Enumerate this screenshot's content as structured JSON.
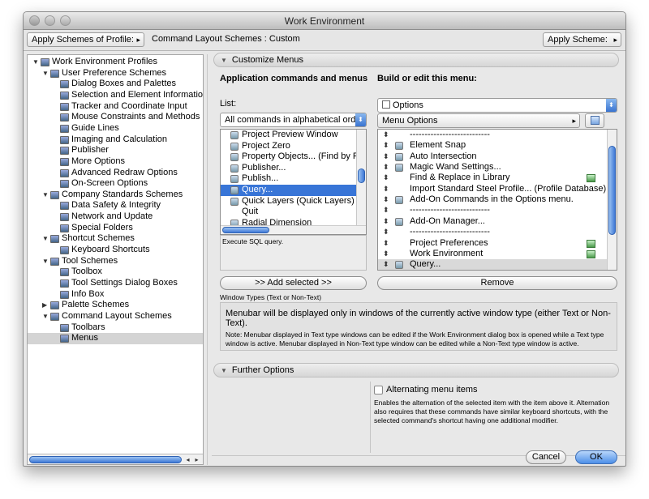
{
  "window": {
    "title": "Work Environment"
  },
  "toolbar": {
    "apply_profile_label": "Apply Schemes of Profile:",
    "scheme_caption": "Command Layout Schemes : Custom",
    "apply_scheme_label": "Apply Scheme:"
  },
  "tree": {
    "items": [
      {
        "label": "Work Environment Profiles",
        "level": 0,
        "expanded": true,
        "icon": "folder-icon"
      },
      {
        "label": "User Preference Schemes",
        "level": 1,
        "expanded": true,
        "icon": "folder-icon"
      },
      {
        "label": "Dialog Boxes and Palettes",
        "level": 2,
        "icon": "dialog-icon"
      },
      {
        "label": "Selection and Element Information",
        "level": 2,
        "icon": "selection-icon"
      },
      {
        "label": "Tracker and Coordinate Input",
        "level": 2,
        "icon": "tracker-icon"
      },
      {
        "label": "Mouse Constraints and Methods",
        "level": 2,
        "icon": "mouse-icon"
      },
      {
        "label": "Guide Lines",
        "level": 2,
        "icon": "guide-icon"
      },
      {
        "label": "Imaging and Calculation",
        "level": 2,
        "icon": "imaging-icon"
      },
      {
        "label": "Publisher",
        "level": 2,
        "icon": "publisher-icon"
      },
      {
        "label": "More Options",
        "level": 2,
        "icon": "options-icon"
      },
      {
        "label": "Advanced Redraw Options",
        "level": 2,
        "icon": "redraw-icon"
      },
      {
        "label": "On-Screen Options",
        "level": 2,
        "icon": "screen-icon"
      },
      {
        "label": "Company Standards Schemes",
        "level": 1,
        "expanded": true,
        "icon": "folder-icon"
      },
      {
        "label": "Data Safety & Integrity",
        "level": 2,
        "icon": "safety-icon"
      },
      {
        "label": "Network and Update",
        "level": 2,
        "icon": "network-icon"
      },
      {
        "label": "Special Folders",
        "level": 2,
        "icon": "folder-icon"
      },
      {
        "label": "Shortcut Schemes",
        "level": 1,
        "expanded": true,
        "icon": "folder-icon"
      },
      {
        "label": "Keyboard Shortcuts",
        "level": 2,
        "icon": "keyboard-icon"
      },
      {
        "label": "Tool Schemes",
        "level": 1,
        "expanded": true,
        "icon": "folder-icon"
      },
      {
        "label": "Toolbox",
        "level": 2,
        "icon": "toolbox-icon"
      },
      {
        "label": "Tool Settings Dialog Boxes",
        "level": 2,
        "icon": "tool-settings-icon"
      },
      {
        "label": "Info Box",
        "level": 2,
        "icon": "info-icon"
      },
      {
        "label": "Palette Schemes",
        "level": 1,
        "expanded": false,
        "icon": "folder-icon"
      },
      {
        "label": "Command Layout Schemes",
        "level": 1,
        "expanded": true,
        "icon": "folder-icon"
      },
      {
        "label": "Toolbars",
        "level": 2,
        "icon": "toolbar-icon"
      },
      {
        "label": "Menus",
        "level": 2,
        "icon": "menu-icon",
        "selected": true
      }
    ]
  },
  "customize": {
    "header": "Customize Menus",
    "app_cmds_heading": "Application commands and menus",
    "list_label": "List:",
    "list_select": "All commands in alphabetical order",
    "commands": [
      {
        "label": "Project Preview Window",
        "icon": "preview-icon"
      },
      {
        "label": "Project Zero",
        "icon": "zero-icon"
      },
      {
        "label": "Property Objects... (Find by Prop",
        "icon": "property-icon"
      },
      {
        "label": "Publisher...",
        "icon": "publisher-icon"
      },
      {
        "label": "Publish...",
        "icon": "publish-icon"
      },
      {
        "label": "Query...",
        "icon": "query-icon",
        "selected": true
      },
      {
        "label": "Quick Layers (Quick Layers)",
        "icon": "layers-icon"
      },
      {
        "label": "Quit",
        "icon": ""
      },
      {
        "label": "Radial Dimension",
        "icon": "radial-icon"
      }
    ],
    "command_desc": "Execute SQL query.",
    "add_selected_label": ">> Add selected >>",
    "build_heading": "Build or edit this menu:",
    "menu_select": "Options",
    "menu_options_label": "Menu Options",
    "menu_items": [
      {
        "label": "---------------------------",
        "icon": "",
        "mark": false
      },
      {
        "label": "Element Snap",
        "icon": "snap-icon",
        "mark": false
      },
      {
        "label": "Auto Intersection",
        "icon": "intersection-icon",
        "mark": false
      },
      {
        "label": "Magic Wand Settings...",
        "icon": "wand-icon",
        "mark": false
      },
      {
        "label": "Find & Replace in Library",
        "icon": "",
        "mark": true
      },
      {
        "label": "Import Standard Steel Profile... (Profile Database)",
        "icon": "",
        "mark": false
      },
      {
        "label": "Add-On Commands in the Options menu.",
        "icon": "addon-icon",
        "mark": false
      },
      {
        "label": "---------------------------",
        "icon": "",
        "mark": false
      },
      {
        "label": "Add-On Manager...",
        "icon": "manager-icon",
        "mark": false
      },
      {
        "label": "---------------------------",
        "icon": "",
        "mark": false
      },
      {
        "label": "Project Preferences",
        "icon": "",
        "mark": true
      },
      {
        "label": "Work Environment",
        "icon": "",
        "mark": true
      },
      {
        "label": "Query...",
        "icon": "query-icon",
        "mark": false,
        "highlight": true
      }
    ],
    "remove_label": "Remove",
    "window_types_label": "Window Types (Text or Non-Text)",
    "window_types_text": "Menubar will be displayed only in windows of the currently active window type (either Text or Non-Text).",
    "window_types_note": "Note: Menubar displayed in Text type windows can be edited if the Work Environment dialog box is opened while a Text type window is active. Menubar displayed in Non-Text type window can be edited while a Non-Text type window is active."
  },
  "further": {
    "header": "Further Options",
    "alt_label": "Alternating menu items",
    "alt_desc": "Enables the alternation of the selected item with the item above it. Alternation also requires that these commands have similar keyboard shortcuts, with the selected command's shortcut having one additional modifier."
  },
  "footer": {
    "cancel_label": "Cancel",
    "ok_label": "OK"
  },
  "colors": {
    "selection": "#3875d7",
    "accent": "#4c8fe8"
  }
}
